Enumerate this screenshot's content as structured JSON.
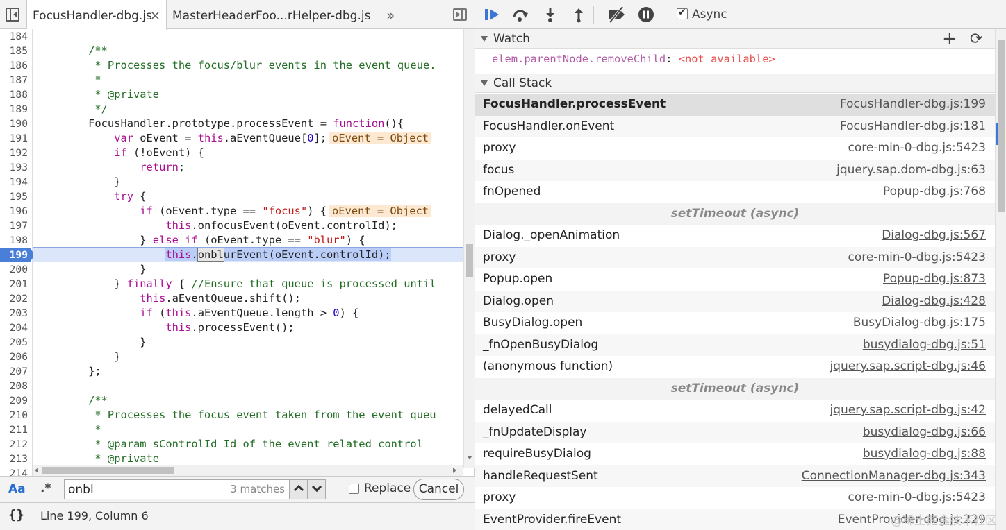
{
  "editor": {
    "tabs": [
      {
        "label": "FocusHandler-dbg.js",
        "active": true
      },
      {
        "label": "MasterHeaderFoo...rHelper-dbg.js",
        "active": false
      }
    ],
    "close_glyph": "×",
    "more_glyph": "»",
    "lines": [
      {
        "n": "184",
        "html": ""
      },
      {
        "n": "185",
        "html": "        <span class='cmt'>/**</span>"
      },
      {
        "n": "186",
        "html": "<span class='cmt'>         * Processes the focus/blur events in the event queue.</span>"
      },
      {
        "n": "187",
        "html": "<span class='cmt'>         *</span>"
      },
      {
        "n": "188",
        "html": "<span class='cmt'>         * @private</span>"
      },
      {
        "n": "189",
        "html": "<span class='cmt'>         */</span>"
      },
      {
        "n": "190",
        "html": "        FocusHandler.prototype.processEvent = <span class='kw'>function</span>(){"
      },
      {
        "n": "191",
        "html": "            <span class='kw'>var</span> oEvent = <span class='kw'>this</span>.aEventQueue[<span class='num'>0</span>];<span class='inline-val'>oEvent = Object</span>"
      },
      {
        "n": "192",
        "html": "            <span class='kw'>if</span> (!oEvent) {"
      },
      {
        "n": "193",
        "html": "                <span class='kw'>return</span>;"
      },
      {
        "n": "194",
        "html": "            }"
      },
      {
        "n": "195",
        "html": "            <span class='kw'>try</span> {"
      },
      {
        "n": "196",
        "html": "                <span class='kw'>if</span> (oEvent.type == <span class='str'>\"focus\"</span>) {<span class='inline-val'>oEvent = Object</span>"
      },
      {
        "n": "197",
        "html": "                    <span class='kw'>this</span>.onfocusEvent(oEvent.controlId);"
      },
      {
        "n": "198",
        "html": "                } <span class='kw'>else if</span> (oEvent.type == <span class='str'>\"blur\"</span>) {"
      },
      {
        "n": "199",
        "html": "                    <span class='hl-sel'><span class='kw'>this</span>.<span class='hl-match'>onbl</span>urEvent(oEvent.controlId);</span>"
      },
      {
        "n": "200",
        "html": "                }"
      },
      {
        "n": "201",
        "html": "            } <span class='kw'>finally</span> { <span class='cmt'>//Ensure that queue is processed until</span>"
      },
      {
        "n": "202",
        "html": "                <span class='kw'>this</span>.aEventQueue.shift();"
      },
      {
        "n": "203",
        "html": "                <span class='kw'>if</span> (<span class='kw'>this</span>.aEventQueue.length > <span class='num'>0</span>) {"
      },
      {
        "n": "204",
        "html": "                    <span class='kw'>this</span>.processEvent();"
      },
      {
        "n": "205",
        "html": "                }"
      },
      {
        "n": "206",
        "html": "            }"
      },
      {
        "n": "207",
        "html": "        };"
      },
      {
        "n": "208",
        "html": ""
      },
      {
        "n": "209",
        "html": "        <span class='cmt'>/**</span>"
      },
      {
        "n": "210",
        "html": "<span class='cmt'>         * Processes the focus event taken from the event queu</span>"
      },
      {
        "n": "211",
        "html": "<span class='cmt'>         *</span>"
      },
      {
        "n": "212",
        "html": "<span class='cmt'>         * @param sControlId Id of the event related control</span>"
      },
      {
        "n": "213",
        "html": "<span class='cmt'>         * @private</span>"
      },
      {
        "n": "214",
        "html": ""
      }
    ],
    "current_line": "199"
  },
  "search": {
    "case_label": "Aa",
    "regex_label": ".*",
    "query": "onbl",
    "match_count": "3 matches",
    "replace_label": "Replace",
    "cancel_label": "Cancel"
  },
  "status": {
    "pretty_print_label": "{}",
    "cursor_position": "Line 199, Column 6"
  },
  "debugger": {
    "async_label": "Async",
    "async_checked": true
  },
  "watch": {
    "title": "Watch",
    "add_glyph": "+",
    "refresh_glyph": "⟳",
    "expressions": [
      {
        "name": "elem.parentNode.removeChild",
        "value": "<not available>"
      }
    ]
  },
  "call_stack": {
    "title": "Call Stack",
    "entries": [
      {
        "kind": "frame",
        "name": "FocusHandler.processEvent",
        "location": "FocusHandler-dbg.js:199",
        "selected": true,
        "link": false
      },
      {
        "kind": "frame",
        "name": "FocusHandler.onEvent",
        "location": "FocusHandler-dbg.js:181",
        "link": false
      },
      {
        "kind": "frame",
        "name": "proxy",
        "location": "core-min-0-dbg.js:5423",
        "link": false
      },
      {
        "kind": "frame",
        "name": "focus",
        "location": "jquery.sap.dom-dbg.js:63",
        "link": false
      },
      {
        "kind": "frame",
        "name": "fnOpened",
        "location": "Popup-dbg.js:768",
        "link": false
      },
      {
        "kind": "async",
        "label": "setTimeout (async)"
      },
      {
        "kind": "frame",
        "name": "Dialog._openAnimation",
        "location": "Dialog-dbg.js:567",
        "link": true
      },
      {
        "kind": "frame",
        "name": "proxy",
        "location": "core-min-0-dbg.js:5423",
        "link": true
      },
      {
        "kind": "frame",
        "name": "Popup.open",
        "location": "Popup-dbg.js:873",
        "link": true
      },
      {
        "kind": "frame",
        "name": "Dialog.open",
        "location": "Dialog-dbg.js:428",
        "link": true
      },
      {
        "kind": "frame",
        "name": "BusyDialog.open",
        "location": "BusyDialog-dbg.js:175",
        "link": true
      },
      {
        "kind": "frame",
        "name": "_fnOpenBusyDialog",
        "location": "busydialog-dbg.js:51",
        "link": true
      },
      {
        "kind": "frame",
        "name": "(anonymous function)",
        "location": "jquery.sap.script-dbg.js:46",
        "link": true
      },
      {
        "kind": "async",
        "label": "setTimeout (async)"
      },
      {
        "kind": "frame",
        "name": "delayedCall",
        "location": "jquery.sap.script-dbg.js:42",
        "link": true
      },
      {
        "kind": "frame",
        "name": "_fnUpdateDisplay",
        "location": "busydialog-dbg.js:66",
        "link": true
      },
      {
        "kind": "frame",
        "name": "requireBusyDialog",
        "location": "busydialog-dbg.js:88",
        "link": true
      },
      {
        "kind": "frame",
        "name": "handleRequestSent",
        "location": "ConnectionManager-dbg.js:343",
        "link": true
      },
      {
        "kind": "frame",
        "name": "proxy",
        "location": "core-min-0-dbg.js:5423",
        "link": true
      },
      {
        "kind": "frame",
        "name": "EventProvider.fireEvent",
        "location": "EventProvider-dbg.js:229",
        "link": true
      }
    ]
  },
  "watermark": "@稀土掘金技术社区"
}
